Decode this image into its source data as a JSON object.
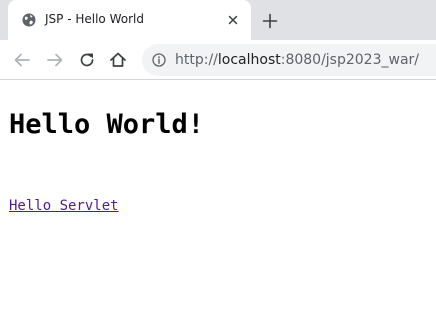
{
  "browser": {
    "tab": {
      "favicon": "globe-icon",
      "title": "JSP - Hello World",
      "close_icon": "close-icon"
    },
    "new_tab_icon": "plus-icon",
    "toolbar": {
      "back_icon": "arrow-left-icon",
      "forward_icon": "arrow-right-icon",
      "reload_icon": "reload-icon",
      "home_icon": "home-icon"
    },
    "address_bar": {
      "info_icon": "info-icon",
      "url_scheme": "http://",
      "url_host": "localhost",
      "url_rest": ":8080/jsp2023_war/"
    }
  },
  "page": {
    "heading": "Hello World!",
    "link_text": "Hello Servlet"
  },
  "colors": {
    "tab_strip": "#dfe1e5",
    "omnibox": "#f1f3f4",
    "visited_link": "#551a8b"
  }
}
